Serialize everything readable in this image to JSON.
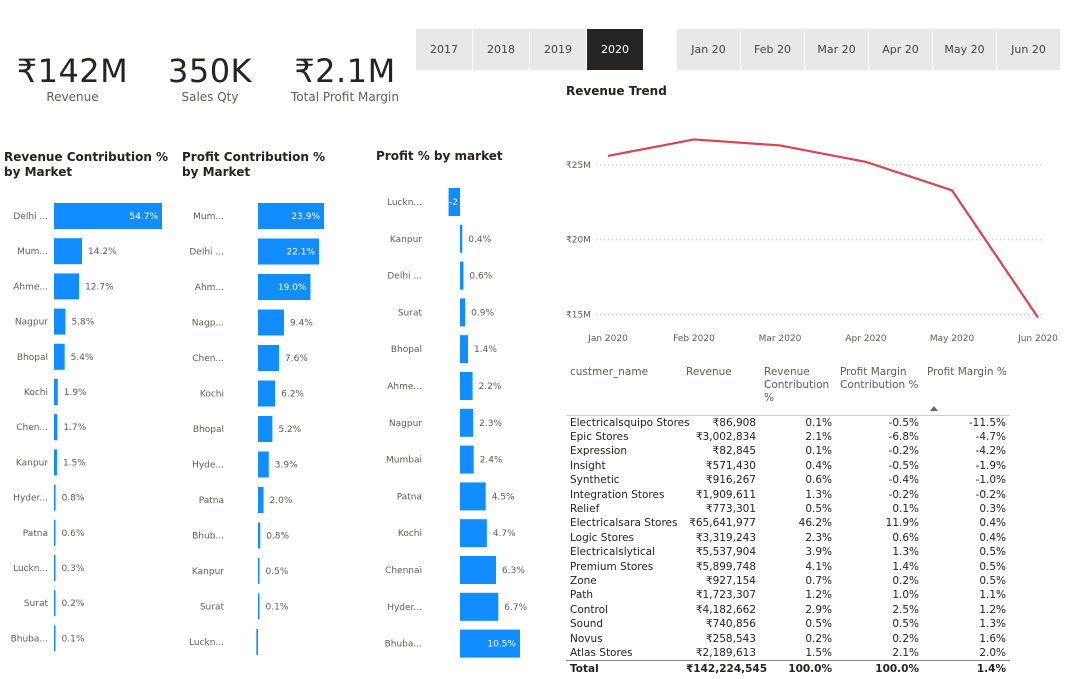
{
  "kpis": [
    {
      "value": "₹142M",
      "label": "Revenue"
    },
    {
      "value": "350K",
      "label": "Sales Qty"
    },
    {
      "value": "₹2.1M",
      "label": "Total Profit Margin"
    }
  ],
  "year_slicer": {
    "items": [
      "2017",
      "2018",
      "2019",
      "2020"
    ],
    "selected": "2020"
  },
  "month_slicer": {
    "items": [
      "Jan 20",
      "Feb 20",
      "Mar 20",
      "Apr 20",
      "May 20",
      "Jun 20"
    ]
  },
  "colors": {
    "bar": "#118dff",
    "line": "#d64550",
    "selected_bg": "#252423",
    "slicer_bg": "#e8e8e8"
  },
  "chart_data": [
    {
      "type": "bar",
      "title": "Revenue Contribution % by Market",
      "categories": [
        "Delhi ...",
        "Mum...",
        "Ahme...",
        "Nagpur",
        "Bhopal",
        "Kochi",
        "Chen...",
        "Kanpur",
        "Hyder...",
        "Patna",
        "Luckn...",
        "Surat",
        "Bhuba..."
      ],
      "values": [
        54.7,
        14.2,
        12.7,
        5.8,
        5.4,
        1.9,
        1.7,
        1.5,
        0.8,
        0.6,
        0.3,
        0.2,
        0.1
      ],
      "labels": [
        "54.7%",
        "14.2%",
        "12.7%",
        "5.8%",
        "5.4%",
        "1.9%",
        "1.7%",
        "1.5%",
        "0.8%",
        "0.6%",
        "0.3%",
        "0.2%",
        "0.1%"
      ]
    },
    {
      "type": "bar",
      "title": "Profit Contribution % by Market",
      "categories": [
        "Mum...",
        "Delhi ...",
        "Ahm...",
        "Nagp...",
        "Chen...",
        "Kochi",
        "Bhopal",
        "Hyde...",
        "Patna",
        "Bhub...",
        "Kanpur",
        "Surat",
        "Luckn..."
      ],
      "values": [
        23.9,
        22.1,
        19.0,
        9.4,
        7.6,
        6.2,
        5.2,
        3.9,
        2.0,
        0.8,
        0.5,
        0.1,
        -0.6
      ],
      "labels": [
        "23.9%",
        "22.1%",
        "19.0%",
        "9.4%",
        "7.6%",
        "6.2%",
        "5.2%",
        "3.9%",
        "2.0%",
        "0.8%",
        "0.5%",
        "0.1%",
        ""
      ]
    },
    {
      "type": "bar",
      "title": "Profit % by market",
      "categories": [
        "Luckn...",
        "Kanpur",
        "Delhi ...",
        "Surat",
        "Bhopal",
        "Ahme...",
        "Nagpur",
        "Mumbai",
        "Patna",
        "Kochi",
        "Chennai",
        "Hyder...",
        "Bhuba..."
      ],
      "values": [
        -2.0,
        0.4,
        0.6,
        0.9,
        1.4,
        2.2,
        2.3,
        2.4,
        4.5,
        4.7,
        6.3,
        6.7,
        10.5
      ],
      "labels": [
        "-2",
        "0.4%",
        "0.6%",
        "0.9%",
        "1.4%",
        "2.2%",
        "2.3%",
        "2.4%",
        "4.5%",
        "4.7%",
        "6.3%",
        "6.7%",
        "10.5%"
      ]
    },
    {
      "type": "line",
      "title": "Revenue Trend",
      "x": [
        "Jan 2020",
        "Feb 2020",
        "Mar 2020",
        "Apr 2020",
        "May 2020",
        "Jun 2020"
      ],
      "values": [
        25.6,
        26.7,
        26.3,
        25.2,
        23.3,
        14.8
      ],
      "yticks": [
        15,
        20,
        25
      ],
      "ytick_labels": [
        "₹15M",
        "₹20M",
        "₹25M"
      ],
      "ylim": [
        14.3,
        28.0
      ]
    }
  ],
  "table": {
    "headers": [
      "custmer_name",
      "Revenue",
      "Revenue Contribution %",
      "Profit Margin Contribution %",
      "Profit Margin %"
    ],
    "rows": [
      [
        "Electricalsquipo Stores",
        "₹86,908",
        "0.1%",
        "-0.5%",
        "-11.5%"
      ],
      [
        "Epic Stores",
        "₹3,002,834",
        "2.1%",
        "-6.8%",
        "-4.7%"
      ],
      [
        "Expression",
        "₹82,845",
        "0.1%",
        "-0.2%",
        "-4.2%"
      ],
      [
        "Insight",
        "₹571,430",
        "0.4%",
        "-0.5%",
        "-1.9%"
      ],
      [
        "Synthetic",
        "₹916,267",
        "0.6%",
        "-0.4%",
        "-1.0%"
      ],
      [
        "Integration Stores",
        "₹1,909,611",
        "1.3%",
        "-0.2%",
        "-0.2%"
      ],
      [
        "Relief",
        "₹773,301",
        "0.5%",
        "0.1%",
        "0.3%"
      ],
      [
        "Electricalsara Stores",
        "₹65,641,977",
        "46.2%",
        "11.9%",
        "0.4%"
      ],
      [
        "Logic Stores",
        "₹3,319,243",
        "2.3%",
        "0.6%",
        "0.4%"
      ],
      [
        "Electricalslytical",
        "₹5,537,904",
        "3.9%",
        "1.3%",
        "0.5%"
      ],
      [
        "Premium Stores",
        "₹5,899,748",
        "4.1%",
        "1.4%",
        "0.5%"
      ],
      [
        "Zone",
        "₹927,154",
        "0.7%",
        "0.2%",
        "0.5%"
      ],
      [
        "Path",
        "₹1,723,307",
        "1.2%",
        "1.0%",
        "1.1%"
      ],
      [
        "Control",
        "₹4,182,662",
        "2.9%",
        "2.5%",
        "1.2%"
      ],
      [
        "Sound",
        "₹740,856",
        "0.5%",
        "0.5%",
        "1.3%"
      ],
      [
        "Novus",
        "₹258,543",
        "0.2%",
        "0.2%",
        "1.6%"
      ],
      [
        "Atlas Stores",
        "₹2,189,613",
        "1.5%",
        "2.1%",
        "2.0%"
      ]
    ],
    "total": [
      "Total",
      "₹142,224,545",
      "100.0%",
      "100.0%",
      "1.4%"
    ]
  }
}
